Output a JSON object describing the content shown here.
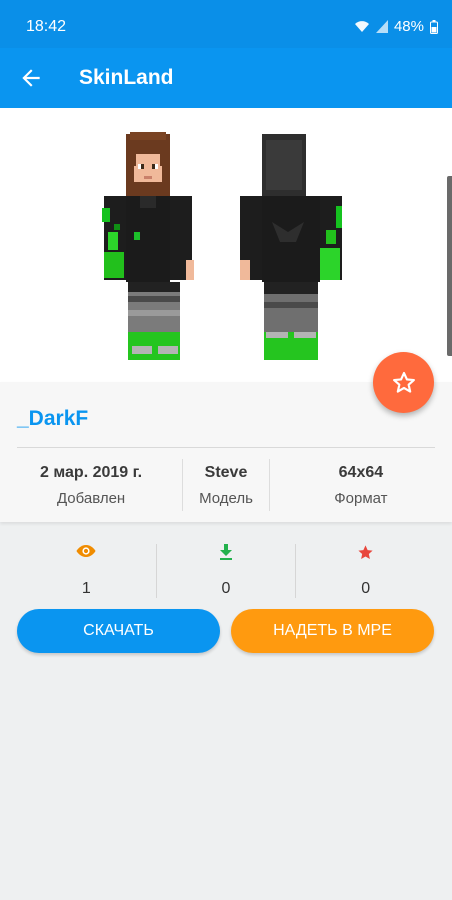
{
  "status_bar": {
    "time": "18:42",
    "battery": "48%"
  },
  "app_bar": {
    "title": "SkinLand"
  },
  "skin": {
    "name": "_DarkF",
    "added_value": "2 мар. 2019 г.",
    "added_label": "Добавлен",
    "model_value": "Steve",
    "model_label": "Модель",
    "format_value": "64x64",
    "format_label": "Формат"
  },
  "stats": {
    "views": "1",
    "downloads": "0",
    "favorites": "0"
  },
  "actions": {
    "download_label": "СКАЧАТЬ",
    "apply_label": "НАДЕТЬ В МРЕ"
  },
  "icons": {
    "back": "arrow-back-icon",
    "favorite": "star-outline-icon",
    "views": "eye-icon",
    "downloads": "download-icon",
    "favorites": "star-icon",
    "wifi": "wifi-icon",
    "signal": "signal-icon",
    "battery": "battery-icon"
  },
  "colors": {
    "primary": "#0a95f0",
    "accent_orange": "#ff9a0f",
    "fab": "#ff6a3d",
    "views_icon": "#f08c00",
    "downloads_icon": "#22b14c",
    "favorites_icon": "#e8463c"
  }
}
